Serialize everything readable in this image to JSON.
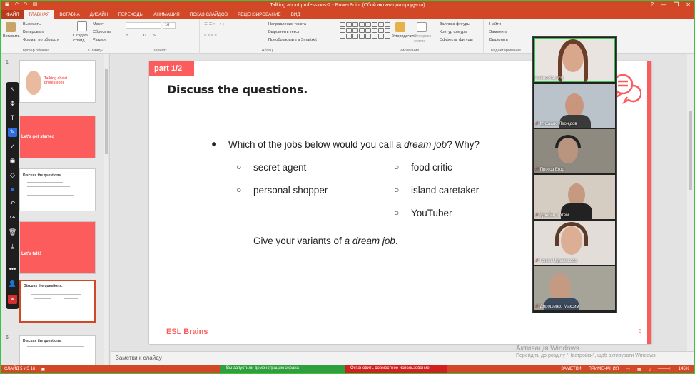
{
  "window": {
    "title": "Talking about professions-2 - PowerPoint (Сбой активации продукта)",
    "controls": [
      "?",
      "—",
      "❐",
      "✕"
    ]
  },
  "tabs": [
    {
      "label": "ФАЙЛ"
    },
    {
      "label": "ГЛАВНАЯ"
    },
    {
      "label": "ВСТАВКА"
    },
    {
      "label": "ДИЗАЙН"
    },
    {
      "label": "ПЕРЕХОДЫ"
    },
    {
      "label": "АНИМАЦИЯ"
    },
    {
      "label": "ПОКАЗ СЛАЙДОВ"
    },
    {
      "label": "РЕЦЕНЗИРОВАНИЕ"
    },
    {
      "label": "ВИД"
    }
  ],
  "ribbon": {
    "clipboard": {
      "paste": "Вставить",
      "cut": "Вырезать",
      "copy": "Копировать",
      "format_painter": "Формат по образцу",
      "label": "Буфер обмена"
    },
    "slides": {
      "new_slide": "Создать слайд",
      "layout": "Макет",
      "reset": "Сбросить",
      "section": "Раздел",
      "label": "Слайды"
    },
    "font": {
      "size": "16",
      "label": "Шрифт"
    },
    "paragraph": {
      "text_direction": "Направление текста",
      "align_text": "Выровнять текст",
      "smartart": "Преобразовать в SmartArt",
      "label": "Абзац"
    },
    "drawing": {
      "arrange": "Упорядочить",
      "quick_styles": "Экспресс-стили",
      "fill": "Заливка фигуры",
      "outline": "Контур фигуры",
      "effects": "Эффекты фигуры",
      "label": "Рисование"
    },
    "editing": {
      "find": "Найти",
      "replace": "Заменить",
      "select": "Выделить",
      "label": "Редактирование"
    }
  },
  "thumbnails": [
    {
      "num": "1",
      "title": "Talking about professions"
    },
    {
      "num": "",
      "title": "Let's get started"
    },
    {
      "num": "",
      "title": "Discuss the questions."
    },
    {
      "num": "",
      "title": ""
    },
    {
      "num": "",
      "title": "Let's talk!"
    },
    {
      "num": "",
      "title": "Discuss the questions."
    },
    {
      "num": "6",
      "title": "Discuss the questions."
    }
  ],
  "slide": {
    "badge": "part 1/2",
    "title": "Discuss the questions.",
    "question_pre": "Which of the jobs below would you call a ",
    "question_em": "dream job",
    "question_post": "? Why?",
    "options_left": [
      "secret agent",
      "personal shopper"
    ],
    "options_right": [
      "food critic",
      "island caretaker",
      "YouTuber"
    ],
    "variants_pre": "Give your variants of ",
    "variants_em": "a dream job",
    "variants_post": ".",
    "brand": "ESL Brains",
    "number": "5",
    "bullet": "●",
    "circle": "○"
  },
  "notes": {
    "placeholder": "Заметки к слайду"
  },
  "activation": {
    "title": "Активація Windows",
    "subtitle": "Перейдіть до розділу \"Настройки\", щоб активувати Windows."
  },
  "statusbar": {
    "slide_info": "СЛАЙД 5 ИЗ 16",
    "sharing": "Вы запустили демонстрацию экрана",
    "stop_sharing": "Остановить совместное использование",
    "notes": "ЗАМЕТКИ",
    "comments": "ПРИМЕЧАНИЯ",
    "zoom": "145%"
  },
  "participants": [
    {
      "name": "Алёна Katrych",
      "muted": false
    },
    {
      "name": "Михайло Леонідов",
      "muted": true
    },
    {
      "name": "Протоз Егор",
      "muted": true
    },
    {
      "name": "Дзюбан Артем",
      "muted": true
    },
    {
      "name": "Ганна Муравльова",
      "muted": true
    },
    {
      "name": "Дорошенко Максим",
      "muted": true
    }
  ],
  "colors": {
    "accent": "#d24726",
    "slide_red": "#fc5c5c",
    "share_green": "#2e9e3e",
    "stop_red": "#d02020"
  }
}
